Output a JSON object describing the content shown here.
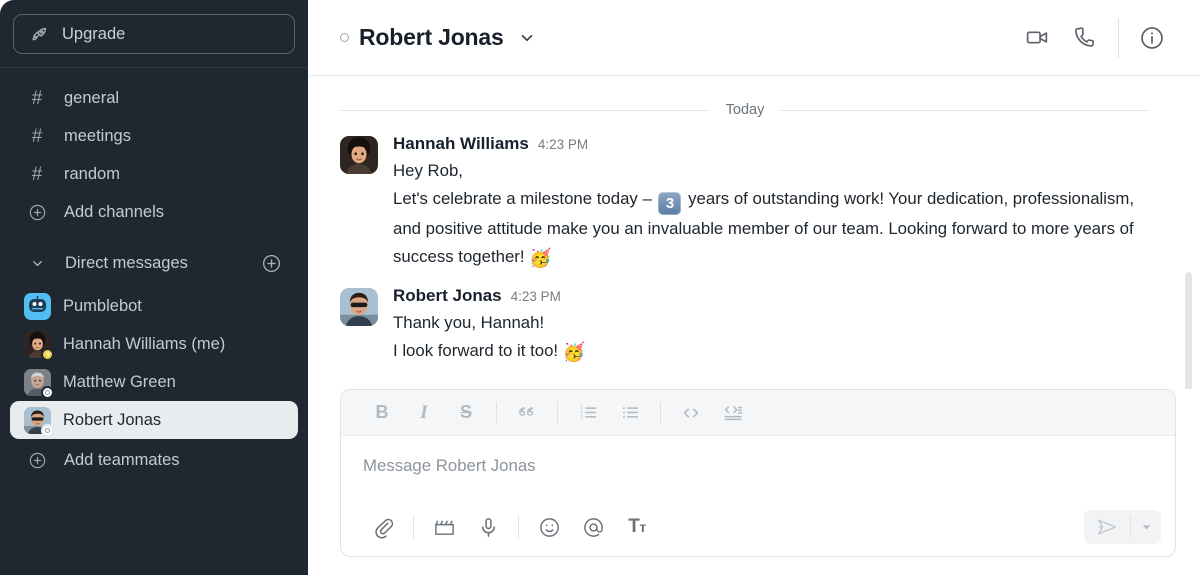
{
  "sidebar": {
    "upgrade": {
      "label": "Upgrade",
      "icon": "rocket-icon"
    },
    "channels": [
      {
        "label": "general",
        "icon": "hash-icon"
      },
      {
        "label": "meetings",
        "icon": "hash-icon"
      },
      {
        "label": "random",
        "icon": "hash-icon"
      },
      {
        "label": "Add channels",
        "icon": "plus-circle-icon"
      }
    ],
    "dm_section": {
      "label": "Direct messages",
      "chevron": "chevron-down-icon",
      "add": "plus-circle-icon"
    },
    "dms": [
      {
        "label": "Pumblebot",
        "avatar": "bot",
        "status": "none",
        "active": false
      },
      {
        "label": "Hannah Williams (me)",
        "avatar": "hannah",
        "status": "dnd",
        "active": false
      },
      {
        "label": "Matthew Green",
        "avatar": "matthew",
        "status": "away",
        "active": false
      },
      {
        "label": "Robert Jonas",
        "avatar": "robert",
        "status": "away",
        "active": true
      }
    ],
    "add_teammates": {
      "label": "Add teammates",
      "icon": "plus-circle-icon"
    }
  },
  "header": {
    "title": "Robert Jonas",
    "status": "away",
    "chevron": "chevron-down-icon",
    "actions": [
      {
        "name": "video-call-button",
        "icon": "video-camera-icon"
      },
      {
        "name": "voice-call-button",
        "icon": "phone-icon"
      },
      {
        "name": "conversation-info-button",
        "icon": "info-circle-icon"
      }
    ]
  },
  "conversation": {
    "day_divider": "Today",
    "messages": [
      {
        "author": "Hannah Williams",
        "time": "4:23 PM",
        "avatar": "hannah",
        "lines": [
          {
            "text": "Hey Rob,"
          },
          {
            "pre": "Let's celebrate a milestone today – ",
            "keycap": "3",
            "post": " years of outstanding work! Your dedication, professionalism, and positive attitude make you an invaluable member of our team. Looking forward to more years of success together! ",
            "emoji": "🥳"
          }
        ]
      },
      {
        "author": "Robert Jonas",
        "time": "4:23 PM",
        "avatar": "robert",
        "lines": [
          {
            "text": "Thank you, Hannah!"
          },
          {
            "text": "I look forward to it too! ",
            "emoji": "🥳"
          }
        ]
      }
    ]
  },
  "composer": {
    "placeholder": "Message Robert Jonas",
    "format_tools": [
      {
        "name": "bold-button",
        "glyph": "B"
      },
      {
        "name": "italic-button",
        "glyph": "I"
      },
      {
        "name": "strikethrough-button",
        "glyph": "S"
      },
      {
        "name": "blockquote-button",
        "glyph": "quote-icon"
      },
      {
        "name": "ordered-list-button",
        "glyph": "ordered-list-icon"
      },
      {
        "name": "bullet-list-button",
        "glyph": "bullet-list-icon"
      },
      {
        "name": "inline-code-button",
        "glyph": "code-icon"
      },
      {
        "name": "code-block-button",
        "glyph": "code-block-icon"
      }
    ],
    "action_tools": [
      {
        "name": "attach-file-button",
        "glyph": "paperclip-icon"
      },
      {
        "name": "record-video-button",
        "glyph": "clapperboard-icon"
      },
      {
        "name": "record-audio-button",
        "glyph": "microphone-icon"
      },
      {
        "name": "emoji-button",
        "glyph": "smiley-icon"
      },
      {
        "name": "mention-button",
        "glyph": "at-icon"
      },
      {
        "name": "formatting-button",
        "glyph": "text-format-icon"
      }
    ],
    "send": {
      "name": "send-button",
      "icon": "send-arrow-icon"
    },
    "send_options": {
      "name": "send-options-button",
      "icon": "chevron-down-icon"
    }
  },
  "colors": {
    "sidebar_bg": "#1f2731",
    "active_item_bg": "#e9ecef",
    "accent_keycap": "#5b7da6",
    "bot_avatar": "#52bdf0"
  }
}
